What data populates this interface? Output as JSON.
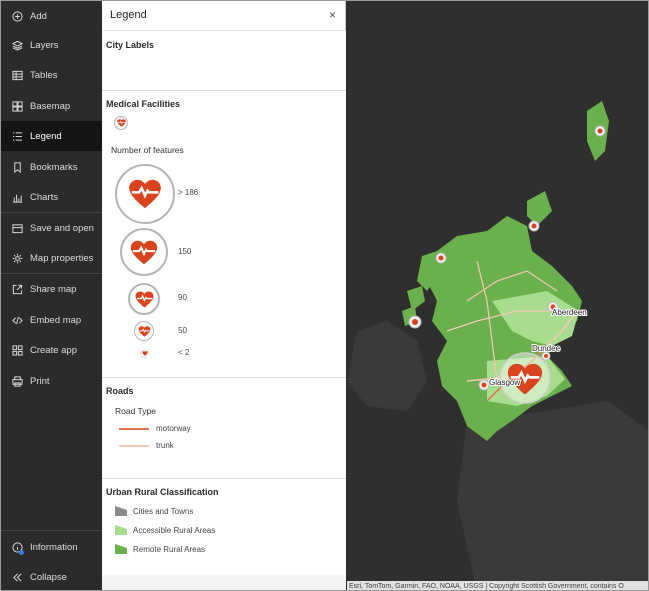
{
  "sidebar": {
    "items": [
      {
        "label": "Add",
        "icon": "add-icon"
      },
      {
        "label": "Layers",
        "icon": "layers-icon"
      },
      {
        "label": "Tables",
        "icon": "table-icon"
      },
      {
        "label": "Basemap",
        "icon": "basemap-icon"
      },
      {
        "label": "Legend",
        "icon": "legend-icon",
        "active": true
      },
      {
        "label": "Bookmarks",
        "icon": "bookmark-icon"
      },
      {
        "label": "Charts",
        "icon": "chart-icon"
      },
      {
        "label": "Save and open",
        "icon": "save-icon"
      },
      {
        "label": "Map properties",
        "icon": "gear-icon"
      },
      {
        "label": "Share map",
        "icon": "share-icon"
      },
      {
        "label": "Embed map",
        "icon": "code-icon"
      },
      {
        "label": "Create app",
        "icon": "apps-icon"
      },
      {
        "label": "Print",
        "icon": "print-icon"
      }
    ],
    "bottom": {
      "information": "Information",
      "collapse": "Collapse"
    }
  },
  "legend": {
    "title": "Legend",
    "close": "×",
    "sections": {
      "city_labels": {
        "title": "City Labels"
      },
      "medical": {
        "title": "Medical Facilities",
        "subtitle": "Number of features",
        "classes": [
          "> 186",
          "150",
          "90",
          "50",
          "< 2"
        ]
      },
      "roads": {
        "title": "Roads",
        "subtitle": "Road Type",
        "classes": [
          "motorway",
          "trunk"
        ]
      },
      "urban_rural": {
        "title": "Urban Rural Classification",
        "classes": [
          "Cities and Towns",
          "Accessible Rural Areas",
          "Remote Rural Areas"
        ]
      }
    }
  },
  "colors": {
    "heart": "#d9431e",
    "motorway": "#e0734f",
    "trunk": "#f6c8b5",
    "cities": "#8a8a8a",
    "accessible_rural": "#a8dd8f",
    "remote_rural": "#6ab04c",
    "map_background": "#2f2f2f"
  },
  "map": {
    "city_labels": [
      "Aberdeen",
      "Dundee",
      "Glasgow"
    ],
    "attribution": "Esri, TomTom, Garmin, FAO, NOAA, USGS | Copyright Scottish Government, contains O"
  }
}
